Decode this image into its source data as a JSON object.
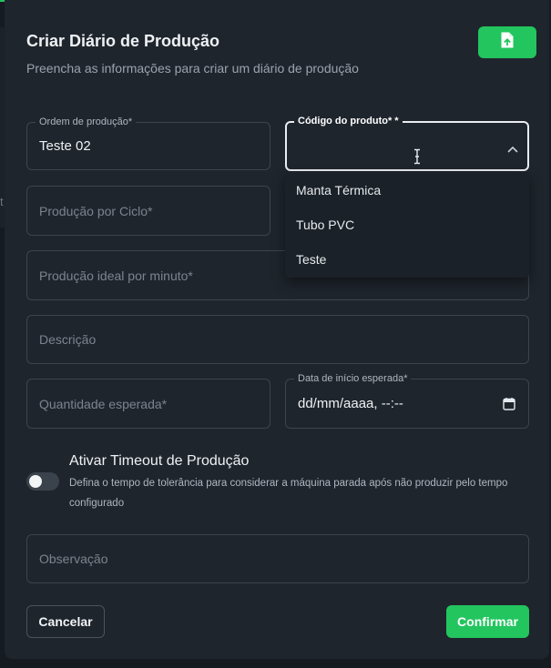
{
  "dialog": {
    "title": "Criar Diário de Produção",
    "subtitle": "Preencha as informações para criar um diário de produção",
    "upload_icon": "file-upload-icon"
  },
  "fields": {
    "production_order": {
      "label": "Ordem de produção*",
      "value": "Teste 02"
    },
    "product_code": {
      "label": "Código do produto* *",
      "value": "",
      "icon": "chevron-up-icon"
    },
    "production_per_cycle": {
      "placeholder": "Produção por Ciclo*"
    },
    "ideal_per_minute": {
      "placeholder": "Produção ideal por minuto*"
    },
    "description": {
      "placeholder": "Descrição"
    },
    "expected_quantity": {
      "placeholder": "Quantidade esperada*"
    },
    "expected_start_date": {
      "label": "Data de início esperada*",
      "value": "dd/mm/aaaa, --:--",
      "icon": "calendar-icon"
    },
    "observation": {
      "placeholder": "Observação"
    }
  },
  "product_options": [
    "Manta Térmica",
    "Tubo PVC",
    "Teste"
  ],
  "timeout": {
    "title": "Ativar Timeout de Produção",
    "description": "Defina o tempo de tolerância para considerar a máquina parada após não produzir pelo tempo configurado",
    "enabled": false
  },
  "actions": {
    "cancel": "Cancelar",
    "confirm": "Confirmar"
  },
  "colors": {
    "accent": "#22c55e",
    "background": "#1f252d"
  }
}
